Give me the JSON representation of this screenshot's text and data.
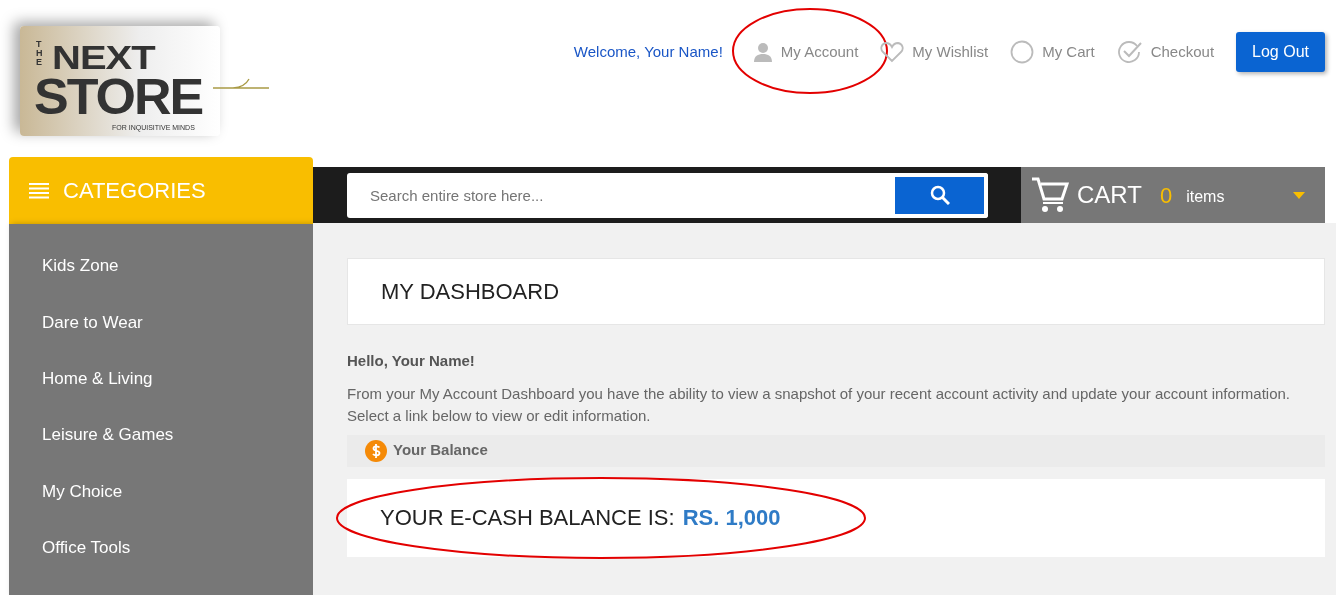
{
  "logo": {
    "word_1": "THE",
    "word_2": "NEXT",
    "word_3": "STORE",
    "tagline": "FOR INQUISITIVE MINDS"
  },
  "header": {
    "welcome": "Welcome, Your Name!",
    "links": [
      {
        "label": "My Account",
        "kind": "account",
        "circled": true
      },
      {
        "label": "My Wishlist",
        "kind": "wishlist",
        "circled": false
      },
      {
        "label": "My Cart",
        "kind": "cart",
        "circled": false
      },
      {
        "label": "Checkout",
        "kind": "checkout",
        "circled": false
      }
    ],
    "logout": "Log Out"
  },
  "categories": {
    "title": "CATEGORIES",
    "items": [
      "Kids Zone",
      "Dare to Wear",
      "Home & Living",
      "Leisure & Games",
      "My Choice",
      "Office Tools"
    ]
  },
  "search": {
    "placeholder": "Search entire store here..."
  },
  "cart": {
    "label": "CART",
    "count": "0",
    "unit": "items"
  },
  "dashboard": {
    "title": "MY DASHBOARD",
    "greeting": "Hello, Your Name!",
    "intro": "From your My Account Dashboard you have the ability to view a snapshot of your recent account activity and update your account information. Select a link below to view or edit information.",
    "balance_heading": "Your Balance",
    "balance_label": "YOUR E-CASH BALANCE IS:",
    "balance_value": "RS. 1,000",
    "balance_circled": true
  }
}
